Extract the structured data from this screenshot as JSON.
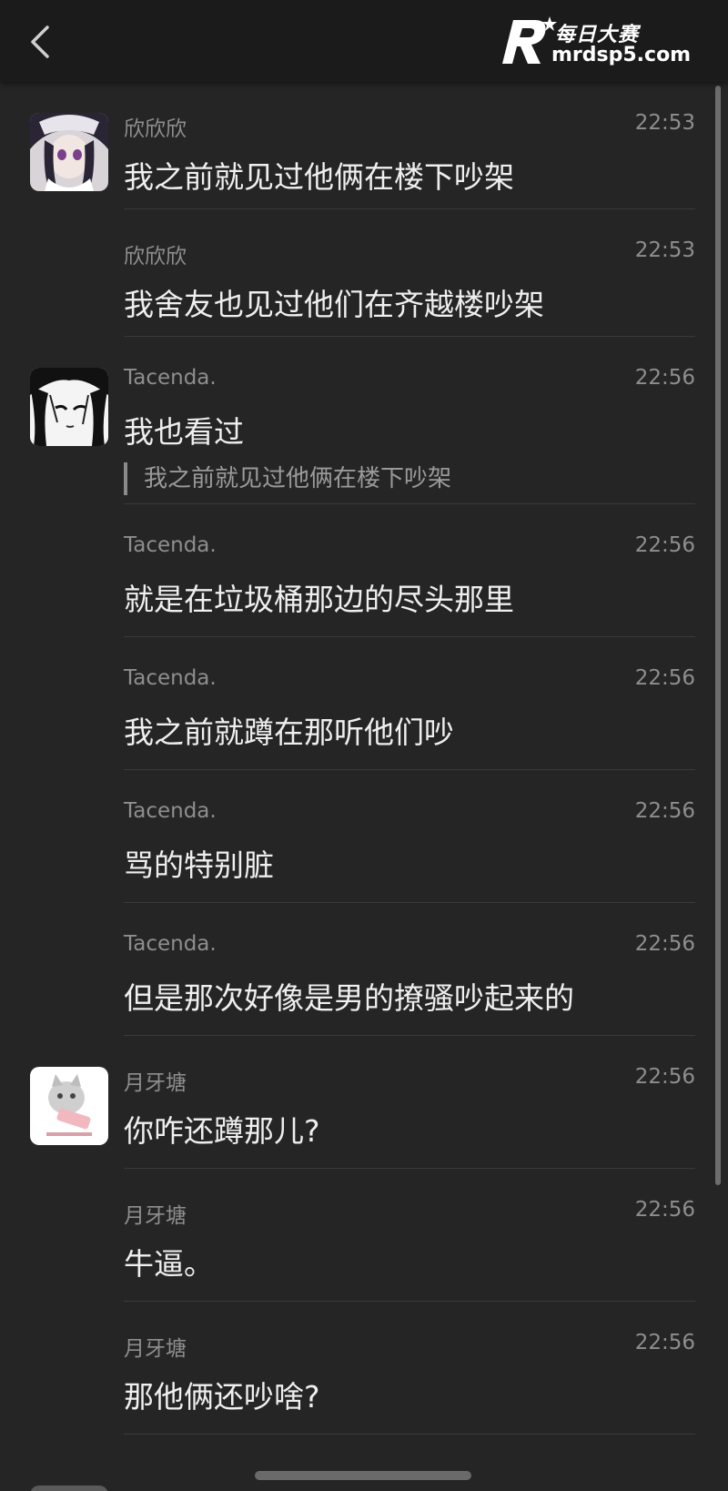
{
  "watermark": {
    "brand_name": "每日大赛",
    "url": "mrdsp5.com"
  },
  "colors": {
    "background": "#252525",
    "topbar": "#1b1b1b",
    "message_text": "#efefef",
    "meta_text": "#8e8e8e",
    "divider": "#3a3a3a"
  },
  "messages": [
    {
      "sender": "欣欣欣",
      "time": "22:53",
      "text": "我之前就见过他俩在楼下吵架",
      "avatar": "anime-girl-avatar"
    },
    {
      "sender": "欣欣欣",
      "time": "22:53",
      "text": "我舍友也见过他们在齐越楼吵架"
    },
    {
      "sender": "Tacenda.",
      "time": "22:56",
      "text": "我也看过",
      "quote": "我之前就见过他俩在楼下吵架",
      "avatar": "manga-avatar"
    },
    {
      "sender": "Tacenda.",
      "time": "22:56",
      "text": "就是在垃圾桶那边的尽头那里"
    },
    {
      "sender": "Tacenda.",
      "time": "22:56",
      "text": "我之前就蹲在那听他们吵"
    },
    {
      "sender": "Tacenda.",
      "time": "22:56",
      "text": "骂的特别脏"
    },
    {
      "sender": "Tacenda.",
      "time": "22:56",
      "text": "但是那次好像是男的撩骚吵起来的"
    },
    {
      "sender": "月牙塘",
      "time": "22:56",
      "text": "你咋还蹲那儿?",
      "avatar": "cat-avatar"
    },
    {
      "sender": "月牙塘",
      "time": "22:56",
      "text": "牛逼。"
    },
    {
      "sender": "月牙塘",
      "time": "22:56",
      "text": "那他俩还吵啥?"
    }
  ]
}
